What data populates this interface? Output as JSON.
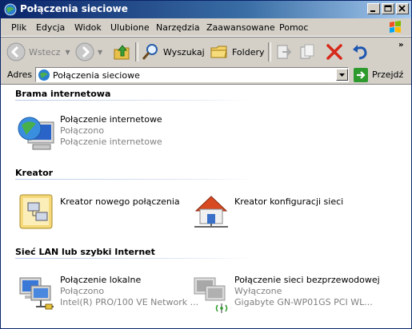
{
  "window": {
    "title": "Połączenia sieciowe"
  },
  "menu": [
    "Plik",
    "Edycja",
    "Widok",
    "Ulubione",
    "Narzędzia",
    "Zaawansowane",
    "Pomoc"
  ],
  "toolbar": {
    "back": "Wstecz",
    "search": "Wyszukaj",
    "folders": "Foldery"
  },
  "address": {
    "label": "Adres",
    "value": "Połączenia sieciowe",
    "go": "Przejdź"
  },
  "groups": [
    {
      "header": "Brama internetowa",
      "items": [
        {
          "name": "Połączenie internetowe",
          "status": "Połączono",
          "detail": "Połączenie internetowe"
        }
      ]
    },
    {
      "header": "Kreator",
      "items": [
        {
          "name": "Kreator nowego połączenia"
        },
        {
          "name": "Kreator konfiguracji sieci"
        }
      ]
    },
    {
      "header": "Sieć LAN lub szybki Internet",
      "items": [
        {
          "name": "Połączenie lokalne",
          "status": "Połączono",
          "detail": "Intel(R) PRO/100 VE Network ..."
        },
        {
          "name": "Połączenie sieci bezprzewodowej",
          "status": "Wyłączone",
          "detail": "Gigabyte GN-WP01GS PCI WL..."
        }
      ]
    }
  ],
  "icons": [
    "network-connections-icon",
    "minimize-icon",
    "maximize-icon",
    "close-icon",
    "windows-logo-icon",
    "back-arrow-icon",
    "forward-arrow-icon",
    "up-folder-icon",
    "search-icon",
    "folders-icon",
    "move-to-icon",
    "copy-to-icon",
    "delete-icon",
    "undo-icon",
    "go-arrow-icon"
  ]
}
